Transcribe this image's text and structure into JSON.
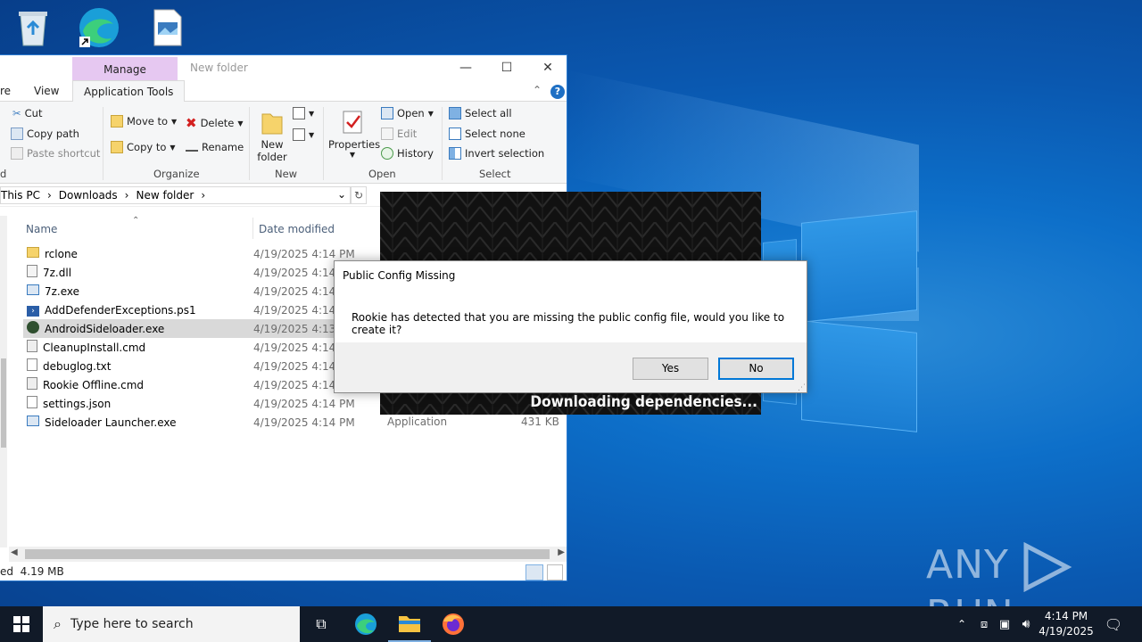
{
  "desktop": {
    "watermark_left": "ANY",
    "watermark_right": "RUN"
  },
  "explorer": {
    "context_tab": "Manage",
    "title": "New folder",
    "tabs": [
      "re",
      "View",
      "Application Tools"
    ],
    "ribbon": {
      "clipboard": {
        "cut": "Cut",
        "copy_path": "Copy path",
        "paste_shortcut": "Paste shortcut",
        "group": "d"
      },
      "organize": {
        "move_to": "Move to",
        "copy_to": "Copy to",
        "delete": "Delete",
        "rename": "Rename",
        "group": "Organize"
      },
      "new": {
        "new_folder_l1": "New",
        "new_folder_l2": "folder",
        "group": "New"
      },
      "open": {
        "properties": "Properties",
        "open": "Open",
        "edit": "Edit",
        "history": "History",
        "group": "Open"
      },
      "select": {
        "select_all": "Select all",
        "select_none": "Select none",
        "invert": "Invert selection",
        "group": "Select"
      }
    },
    "address": {
      "crumbs": [
        "This PC",
        "Downloads",
        "New folder"
      ]
    },
    "columns": {
      "name": "Name",
      "date": "Date modified"
    },
    "files": [
      {
        "name": "rclone",
        "date": "4/19/2025 4:14 PM",
        "icon": "folder-icon"
      },
      {
        "name": "7z.dll",
        "date": "4/19/2025 4:14 P",
        "icon": "dll-icon"
      },
      {
        "name": "7z.exe",
        "date": "4/19/2025 4:14 P",
        "icon": "exe-icon"
      },
      {
        "name": "AddDefenderExceptions.ps1",
        "date": "4/19/2025 4:14 P",
        "icon": "powershell-icon"
      },
      {
        "name": "AndroidSideloader.exe",
        "date": "4/19/2025 4:13 P",
        "icon": "android-exe-icon"
      },
      {
        "name": "CleanupInstall.cmd",
        "date": "4/19/2025 4:14 P",
        "icon": "cmd-icon"
      },
      {
        "name": "debuglog.txt",
        "date": "4/19/2025 4:14 P",
        "icon": "text-file-icon"
      },
      {
        "name": "Rookie Offline.cmd",
        "date": "4/19/2025 4:14 P",
        "icon": "cmd-icon"
      },
      {
        "name": "settings.json",
        "date": "4/19/2025 4:14 PM",
        "icon": "json-file-icon"
      },
      {
        "name": "Sideloader Launcher.exe",
        "date": "4/19/2025 4:14 PM",
        "icon": "exe-icon"
      }
    ],
    "last_row_type": "Application",
    "last_row_size": "431 KB",
    "status": "ed  4.19 MB"
  },
  "loader": {
    "text": "Downloading dependencies..."
  },
  "dialog": {
    "title": "Public Config Missing",
    "message": "Rookie has detected that you are missing the public config file, would you like to create it?",
    "yes": "Yes",
    "no": "No"
  },
  "taskbar": {
    "search_placeholder": "Type here to search",
    "time": "4:14 PM",
    "date": "4/19/2025"
  },
  "colors": {
    "accent": "#0078d7",
    "manage_tab": "#e6c8f1",
    "taskbar": "#111a28"
  }
}
